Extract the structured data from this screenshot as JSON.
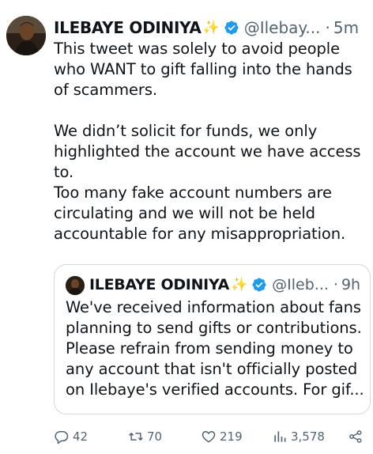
{
  "tweet": {
    "author_name": "ILEBAYE ODINIYA",
    "author_emoji": "✨",
    "handle": "@Ilebay...",
    "separator": "·",
    "time": "5m",
    "paragraphs": [
      "This tweet was solely to avoid people who WANT to gift falling into the hands of scammers.",
      "We didn’t solicit for funds, we only highlighted the account we have access to.\nToo many fake account numbers are circulating and we will not be held accountable for any misappropriation."
    ]
  },
  "quoted_tweet": {
    "author_name": "ILEBAYE ODINIYA",
    "author_emoji": "✨",
    "handle": "@Ileb...",
    "separator": "·",
    "time": "9h",
    "text": "We've received information about fans planning to send gifts or contributions. Please refrain from sending money to any account that isn't officially posted on Ilebaye's verified accounts. For gif..."
  },
  "actions": {
    "replies": "42",
    "retweets": "70",
    "likes": "219",
    "views": "3,578"
  },
  "colors": {
    "text": "#0f1419",
    "secondary": "#536471",
    "verified": "#1d9bf0",
    "border": "#cfd9de"
  }
}
